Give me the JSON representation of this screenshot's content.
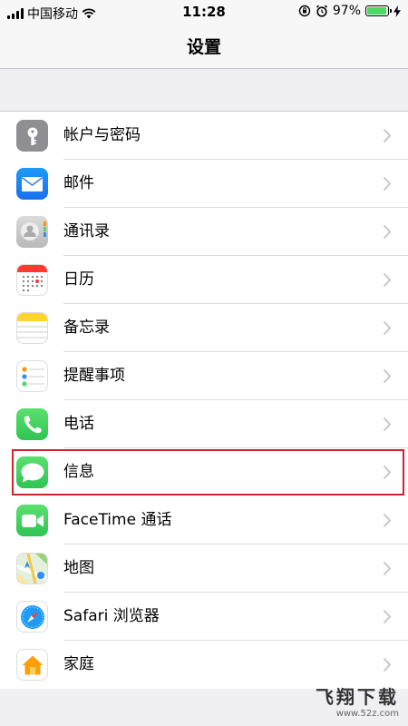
{
  "status_bar": {
    "carrier": "中国移动",
    "time": "11:28",
    "battery": "97%",
    "battery_level": 0.97
  },
  "nav": {
    "title": "设置"
  },
  "settings": [
    {
      "label": "帐户与密码",
      "icon": "key-icon",
      "color": "#8e8e93"
    },
    {
      "label": "邮件",
      "icon": "mail-icon",
      "color": "#2f8ef5"
    },
    {
      "label": "通讯录",
      "icon": "contacts-icon",
      "color": "#c7c7c7"
    },
    {
      "label": "日历",
      "icon": "calendar-icon",
      "color": "#ffffff"
    },
    {
      "label": "备忘录",
      "icon": "notes-icon",
      "color": "#ffffff"
    },
    {
      "label": "提醒事项",
      "icon": "reminders-icon",
      "color": "#ffffff"
    },
    {
      "label": "电话",
      "icon": "phone-icon",
      "color": "#34c759"
    },
    {
      "label": "信息",
      "icon": "messages-icon",
      "color": "#34c759"
    },
    {
      "label": "FaceTime 通话",
      "icon": "facetime-icon",
      "color": "#34c759"
    },
    {
      "label": "地图",
      "icon": "maps-icon",
      "color": "#e8f3e4"
    },
    {
      "label": "Safari 浏览器",
      "icon": "safari-icon",
      "color": "#ffffff"
    },
    {
      "label": "家庭",
      "icon": "home-icon",
      "color": "#ffffff"
    }
  ],
  "watermark": {
    "main": "飞翔下载",
    "sub": "www.52z.com"
  }
}
